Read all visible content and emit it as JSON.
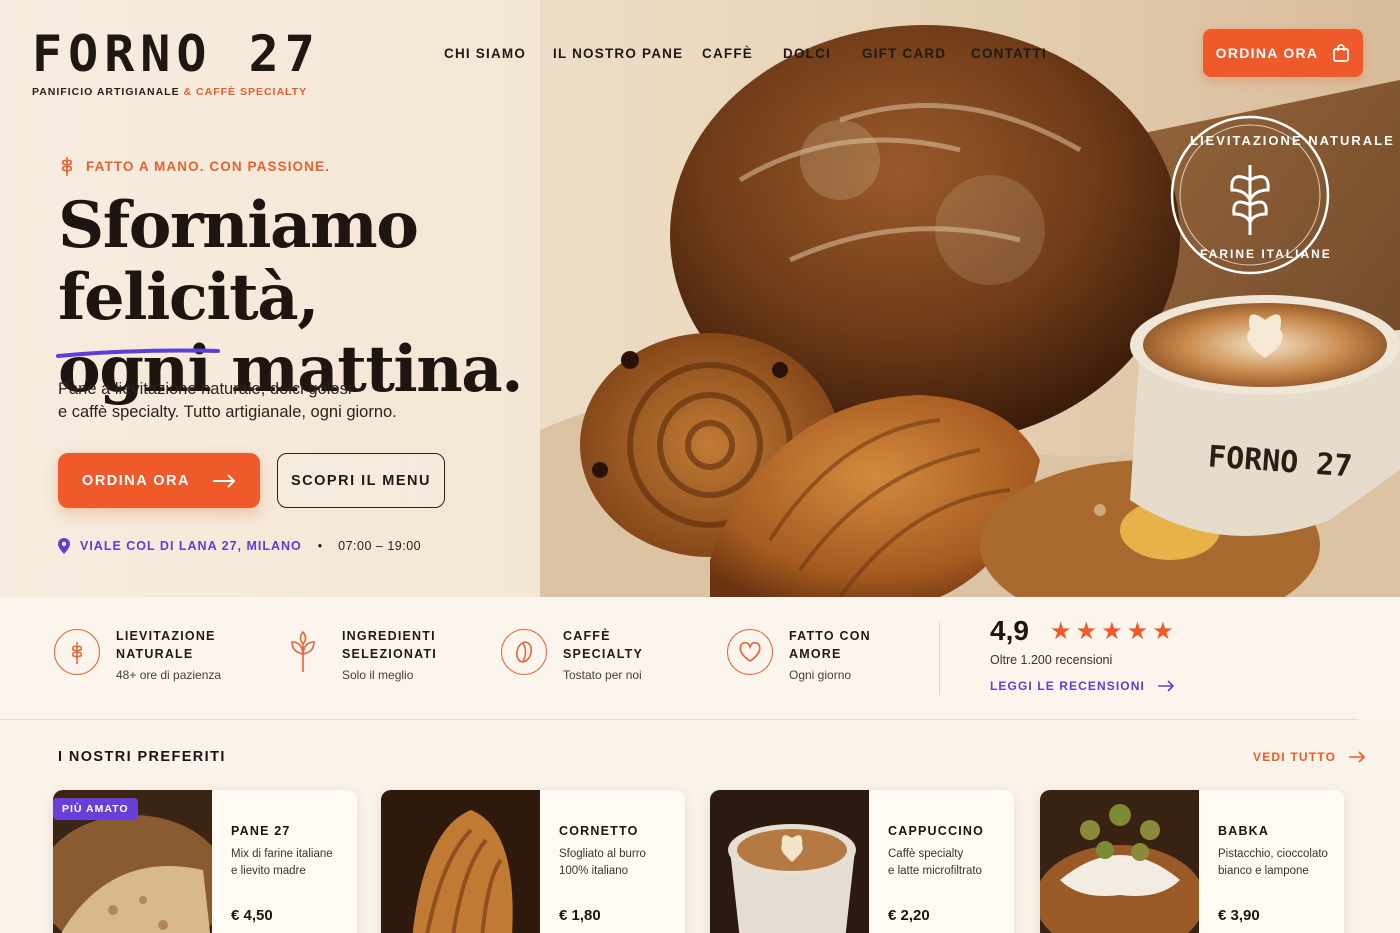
{
  "brand": {
    "name": "FORNO 27",
    "tagline_main": "PANIFICIO ARTIGIANALE",
    "tagline_join": "&",
    "tagline_accent": "CAFFÈ SPECIALTY"
  },
  "nav": {
    "items": [
      "CHI SIAMO",
      "IL NOSTRO PANE",
      "CAFFÈ",
      "DOLCI",
      "GIFT CARD",
      "CONTATTI"
    ],
    "cta_label": "ORDINA ORA"
  },
  "hero": {
    "kicker": "FATTO A MANO. CON PASSIONE.",
    "headline_line1": "Sforniamo felicità,",
    "headline_line2": "ogni mattina.",
    "subtext_line1": "Pane a lievitazione naturale, dolci golosi",
    "subtext_line2": "e caffè specialty. Tutto artigianale, ogni giorno.",
    "primary_cta": "ORDINA ORA",
    "secondary_cta": "SCOPRI IL MENU",
    "address": "VIALE COL DI LANA 27, MILANO",
    "separator": "•",
    "hours": "07:00 – 19:00",
    "stamp_top": "LIEVITAZIONE NATURALE",
    "stamp_bottom": "FARINE ITALIANE",
    "cup_text": "FORNO 27"
  },
  "features": [
    {
      "title_line1": "LIEVITAZIONE",
      "title_line2": "NATURALE",
      "sub": "48+ ore di pazienza",
      "icon": "wheat-cycle-icon"
    },
    {
      "title_line1": "INGREDIENTI",
      "title_line2": "SELEZIONATI",
      "sub": "Solo il meglio",
      "icon": "sprout-icon"
    },
    {
      "title_line1": "CAFFÈ",
      "title_line2": "SPECIALTY",
      "sub": "Tostato per noi",
      "icon": "coffee-bean-icon"
    },
    {
      "title_line1": "FATTO CON",
      "title_line2": "AMORE",
      "sub": "Ogni giorno",
      "icon": "heart-icon"
    }
  ],
  "rating": {
    "score": "4,9",
    "stars": 5,
    "count": "Oltre 1.200 recensioni",
    "link": "LEGGI LE RECENSIONI"
  },
  "favorites": {
    "title": "I NOSTRI PREFERITI",
    "see_all": "VEDI TUTTO",
    "badge": "PIÙ AMATO",
    "items": [
      {
        "name": "PANE 27",
        "desc_line1": "Mix di farine italiane",
        "desc_line2": "e lievito madre",
        "price": "€ 4,50"
      },
      {
        "name": "CORNETTO",
        "desc_line1": "Sfogliato al burro",
        "desc_line2": "100% italiano",
        "price": "€ 1,80"
      },
      {
        "name": "CAPPUCCINO",
        "desc_line1": "Caffè specialty",
        "desc_line2": "e latte microfiltrato",
        "price": "€ 2,20"
      },
      {
        "name": "BABKA",
        "desc_line1": "Pistacchio, cioccolato",
        "desc_line2": "bianco e lampone",
        "price": "€ 3,90"
      }
    ]
  },
  "colors": {
    "accent": "#f0592a",
    "purple": "#5b3fd6",
    "dark": "#1e1510",
    "background": "#faf3ea"
  }
}
